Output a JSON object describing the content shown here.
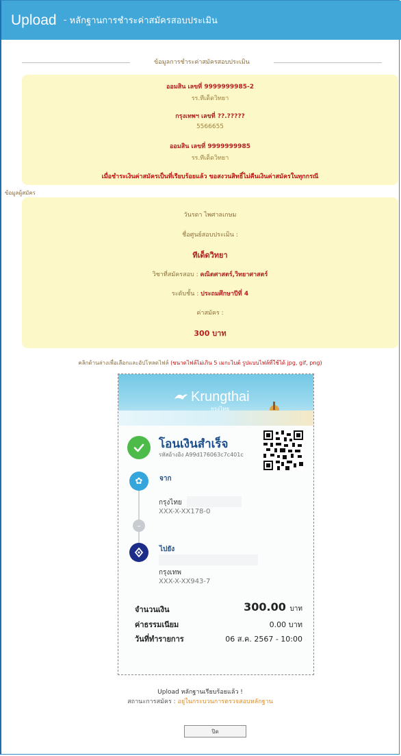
{
  "header": {
    "title_main": "Upload",
    "title_sep": " - ",
    "title_sub": "หลักฐานการชำระค่าสมัครสอบประเมิน"
  },
  "payment_section": {
    "divider_label": "ข้อมูลการชำระค่าสมัครสอบประเมิน",
    "banks": [
      {
        "title": "ออมสิน เลขที่ 9999999985-2",
        "name": "รร.ทีเด็ดวิทยา"
      },
      {
        "title": "กรุงเทพฯ เลขที่ ??.?????",
        "name": "5566655"
      },
      {
        "title": "ออมสิน เลขที่ 9999999985",
        "name": "รร.ทีเด็ดวิทยา"
      }
    ],
    "warning": "เมื่อชำระเงินค่าสมัครเป็นที่เรียบร้อยแล้ว ขอสงวนสิทธิ์ไม่คืนเงินค่าสมัครในทุกกรณี"
  },
  "applicant": {
    "section_label": "ข้อมูลผู้สมัคร",
    "name": "วันรดา ไพศาลเกษม",
    "center_label": "ชื่อศูนย์สอบประเมิน :",
    "center_value": "ทีเด็ดวิทยา",
    "subject_label": "วิชาที่สมัครสอบ : ",
    "subject_value": "คณิตศาสตร์,วิทยาศาสตร์",
    "level_label": "ระดับชั้น : ",
    "level_value": "ประถมศึกษาปีที่ 4",
    "fee_label": "ค่าสมัคร :",
    "fee_value": "300 บาท"
  },
  "instruction": {
    "text": "คลิกด้านล่างเพื่อเลือกและอัปโหลดไฟล์ ",
    "note": "(ขนาดไฟล์ไม่เกิน 5 เมกะไบต์ รูปแบบไฟล์ที่ใช้ได้ jpg, gif, png)"
  },
  "slip": {
    "brand": "Krungthai",
    "brand_sub": "กรุงไทย",
    "success_text": "โอนเงินสำเร็จ",
    "ref_label": "รหัสอ้างอิง",
    "ref_value": "A99d176063c7c401c",
    "from_label": "จาก",
    "from_bank": "กรุงไทย",
    "from_account": "XXX-X-XX178-0",
    "to_label": "ไปยัง",
    "to_bank": "กรุงเทพ",
    "to_account": "XXX-X-XX943-7",
    "amount_label": "จำนวนเงิน",
    "amount_value": "300.00",
    "amount_unit": "บาท",
    "fee_label": "ค่าธรรมเนียม",
    "fee_value": "0.00 บาท",
    "date_label": "วันที่ทำรายการ",
    "date_value": "06 ส.ค. 2567 - 10:00",
    "colors": {
      "success": "#4cbb4a",
      "ktb": "#35a6dc",
      "bbl": "#1c2c89"
    },
    "icons": [
      "check-icon",
      "ktb-logo-icon",
      "chevron-down-icon",
      "bbl-logo-icon",
      "qr-code-icon"
    ]
  },
  "footer": {
    "upload_done": "Upload หลักฐานเรียบร้อยแล้ว !",
    "status_label": "สถานะการสมัคร : ",
    "status_value": "อยู่ในกระบวนการตรวจสอบหลักฐาน",
    "close_button": "ปิด"
  },
  "colors": {
    "header": "#41a6d8",
    "panel": "#fcf8c8",
    "accent_red": "#b51f1f",
    "status_orange": "#e08a1e"
  }
}
